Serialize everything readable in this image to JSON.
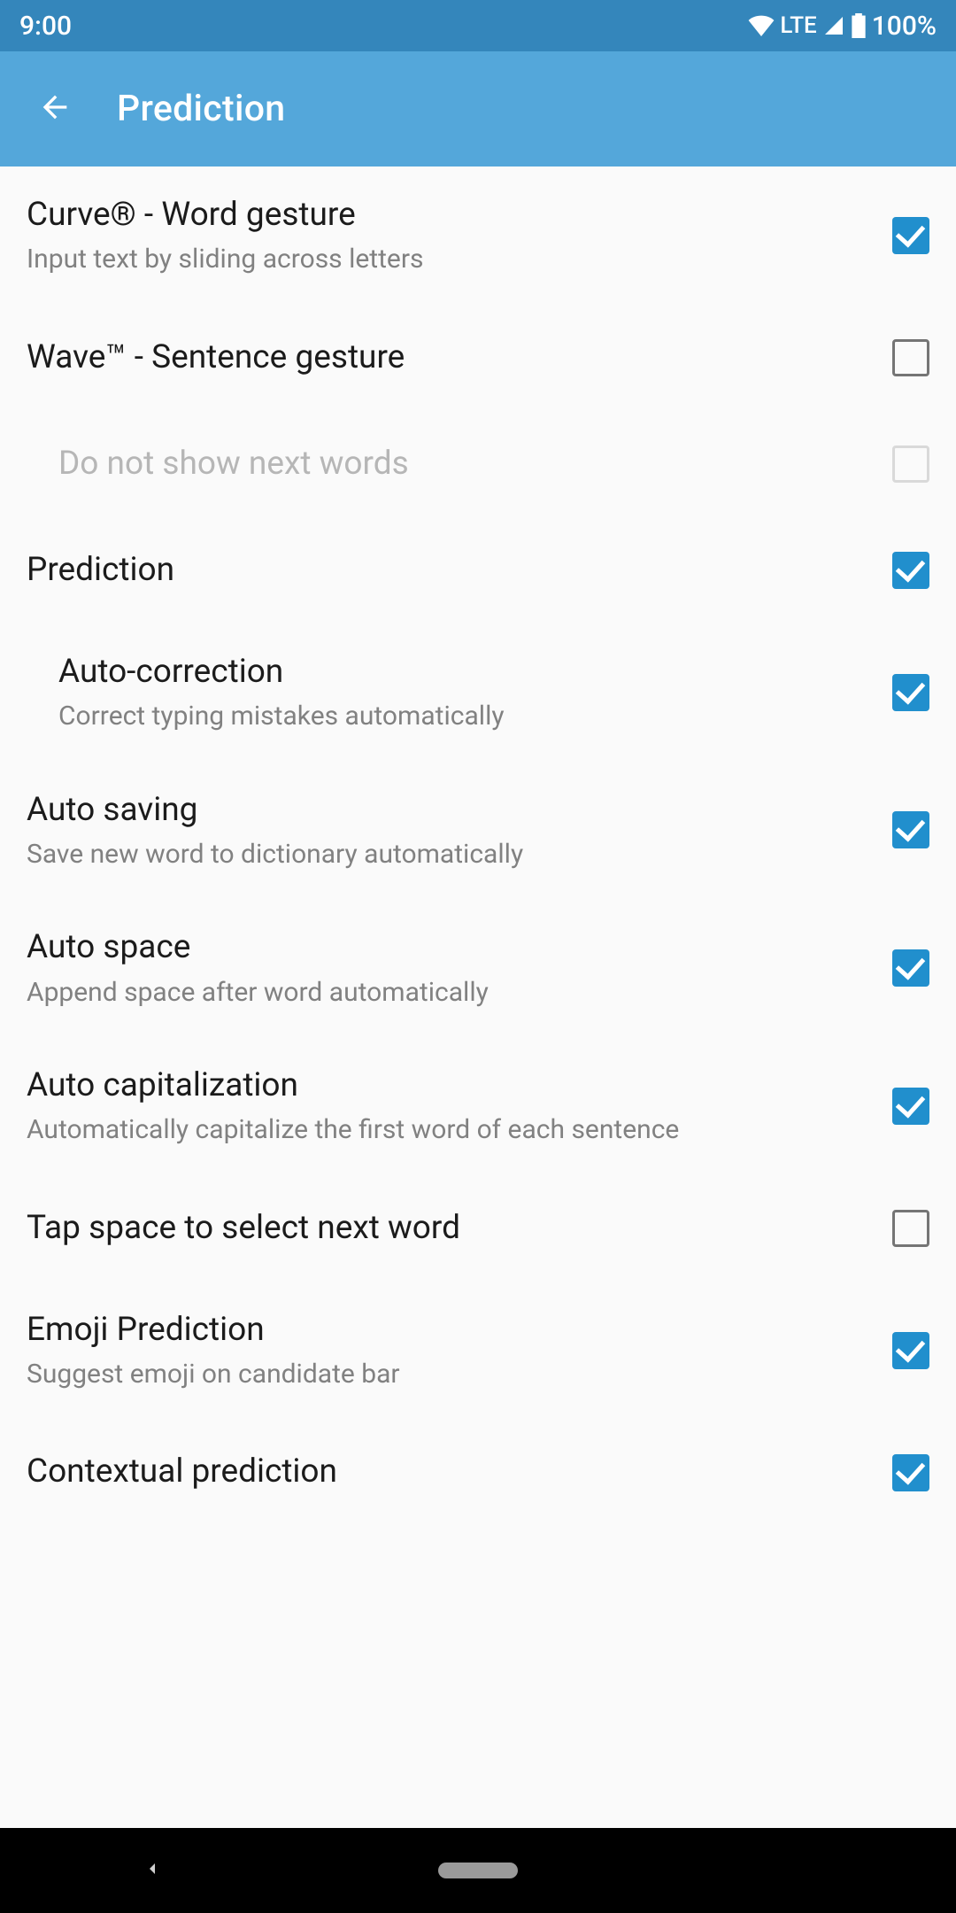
{
  "status": {
    "time": "9:00",
    "network": "LTE",
    "battery": "100%"
  },
  "header": {
    "title": "Prediction"
  },
  "items": [
    {
      "title": "Curve® - Word gesture",
      "sub": "Input text by sliding across letters",
      "checked": true,
      "indent": false,
      "disabled": false
    },
    {
      "title": "Wave™ - Sentence gesture",
      "sub": "",
      "checked": false,
      "indent": false,
      "disabled": false
    },
    {
      "title": "Do not show next words",
      "sub": "",
      "checked": false,
      "indent": true,
      "disabled": true
    },
    {
      "title": "Prediction",
      "sub": "",
      "checked": true,
      "indent": false,
      "disabled": false
    },
    {
      "title": "Auto-correction",
      "sub": "Correct typing mistakes automatically",
      "checked": true,
      "indent": true,
      "disabled": false
    },
    {
      "title": "Auto saving",
      "sub": "Save new word to dictionary automatically",
      "checked": true,
      "indent": false,
      "disabled": false
    },
    {
      "title": "Auto space",
      "sub": "Append space after word automatically",
      "checked": true,
      "indent": false,
      "disabled": false
    },
    {
      "title": "Auto capitalization",
      "sub": "Automatically capitalize the first word of each sentence",
      "checked": true,
      "indent": false,
      "disabled": false
    },
    {
      "title": "Tap space to select next word",
      "sub": "",
      "checked": false,
      "indent": false,
      "disabled": false
    },
    {
      "title": "Emoji Prediction",
      "sub": "Suggest emoji on candidate bar",
      "checked": true,
      "indent": false,
      "disabled": false
    },
    {
      "title": "Contextual prediction",
      "sub": "",
      "checked": true,
      "indent": false,
      "disabled": false
    }
  ]
}
